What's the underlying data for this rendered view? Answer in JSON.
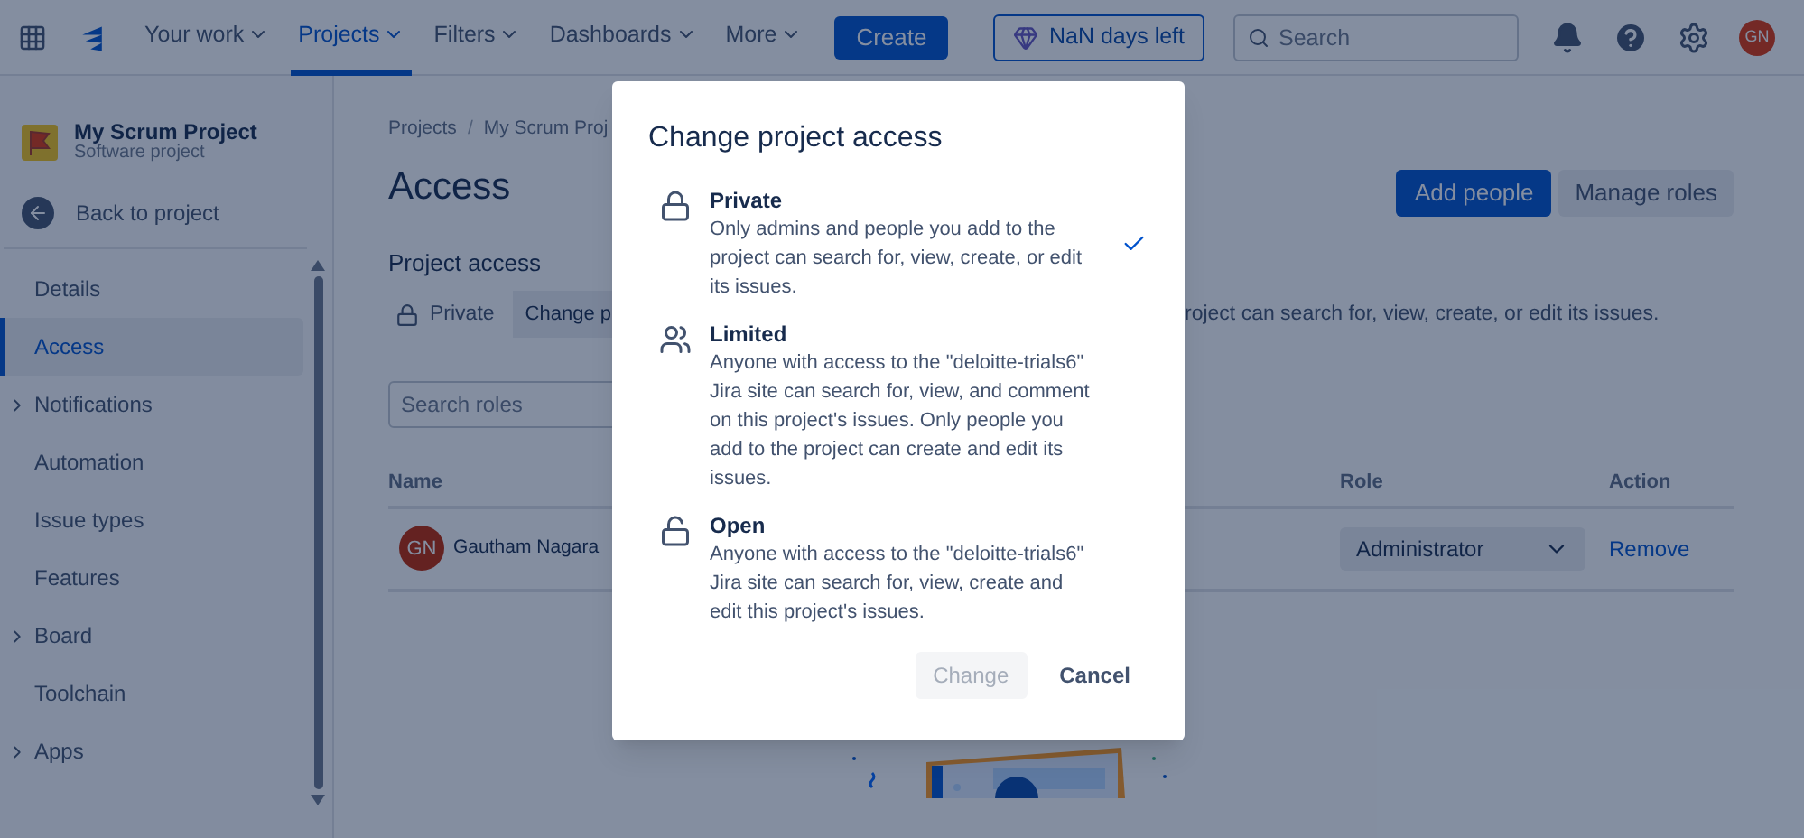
{
  "topnav": {
    "items": [
      {
        "label": "Your work",
        "selected": false
      },
      {
        "label": "Projects",
        "selected": true
      },
      {
        "label": "Filters",
        "selected": false
      },
      {
        "label": "Dashboards",
        "selected": false
      },
      {
        "label": "More",
        "selected": false
      }
    ],
    "create": "Create",
    "trial": "NaN days left",
    "search": {
      "placeholder": "Search"
    },
    "avatar": "GN"
  },
  "sidebar": {
    "project": {
      "name": "My Scrum Project",
      "type": "Software project"
    },
    "back": "Back to project",
    "items": [
      {
        "label": "Details",
        "selected": false,
        "kind": "link"
      },
      {
        "label": "Access",
        "selected": true,
        "kind": "link"
      },
      {
        "label": "Notifications",
        "selected": false,
        "kind": "group"
      },
      {
        "label": "Automation",
        "selected": false,
        "kind": "link"
      },
      {
        "label": "Issue types",
        "selected": false,
        "kind": "link"
      },
      {
        "label": "Features",
        "selected": false,
        "kind": "link"
      },
      {
        "label": "Board",
        "selected": false,
        "kind": "group"
      },
      {
        "label": "Toolchain",
        "selected": false,
        "kind": "link"
      },
      {
        "label": "Apps",
        "selected": false,
        "kind": "group"
      }
    ]
  },
  "main": {
    "breadcrumbs": [
      {
        "kind": "link",
        "text": "Projects"
      },
      {
        "kind": "separator",
        "text": "/"
      },
      {
        "kind": "link",
        "text": "My Scrum Proj"
      }
    ],
    "title": "Access",
    "buttons": {
      "add": "Add people",
      "manage": "Manage roles"
    },
    "project_access": {
      "heading": "Project access",
      "level": "Private",
      "change": "Change p",
      "note": "roject can search for, view, create, or edit its issues."
    },
    "search": {
      "placeholder": "Search roles"
    },
    "table": {
      "columns": [
        "Name",
        "Role",
        "Action"
      ],
      "rows": [
        {
          "avatar": "GN",
          "name": "Gautham Nagara",
          "role": "Administrator",
          "action": "Remove"
        }
      ]
    }
  },
  "modal": {
    "title": "Change project access",
    "options": [
      {
        "kind": "private",
        "name": "Private",
        "description": "Only admins and people you add to the project can search for, view, create, or edit its issues.",
        "selected": true
      },
      {
        "kind": "limited",
        "name": "Limited",
        "description": "Anyone with access to the \"deloitte-trials6\" Jira site can search for, view, and comment on this project's issues. Only people you add to the project can create and edit its issues.",
        "selected": false
      },
      {
        "kind": "open",
        "name": "Open",
        "description": "Anyone with access to the \"deloitte-trials6\" Jira site can search for, view, create and edit this project's issues.",
        "selected": false
      }
    ],
    "buttons": [
      {
        "label": "Change",
        "disabled": true
      },
      {
        "label": "Cancel",
        "disabled": false
      }
    ]
  }
}
